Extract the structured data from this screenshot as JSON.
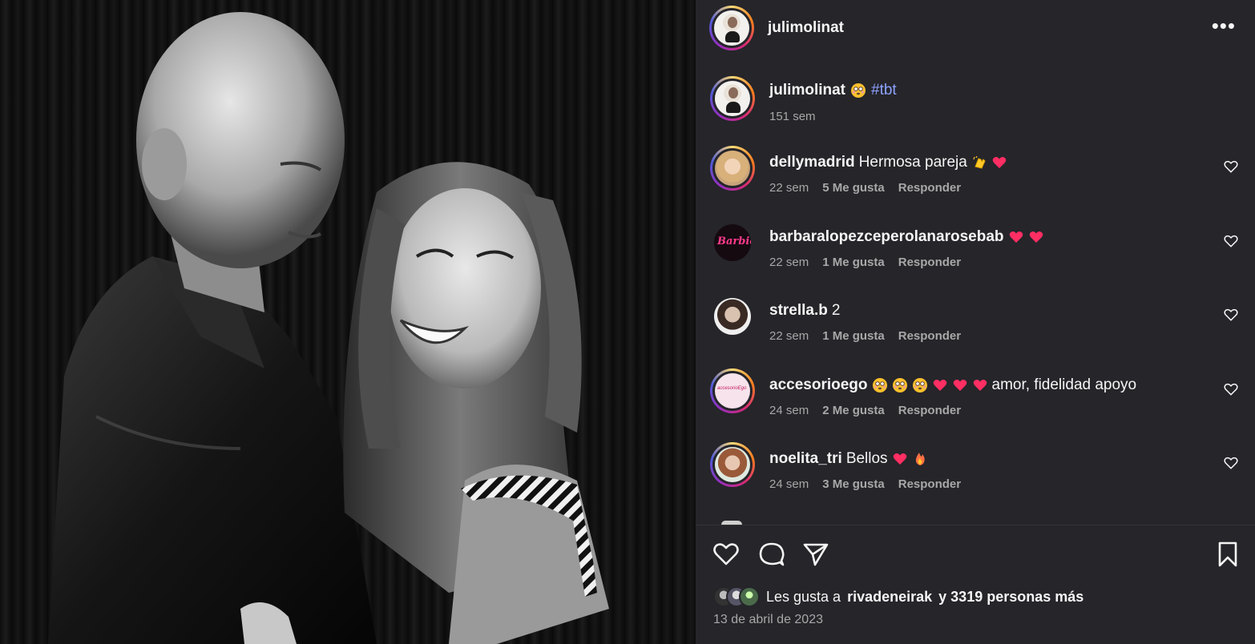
{
  "post": {
    "author": "julimolinat",
    "caption_hashtag": "#tbt",
    "caption_age": "151 sem",
    "likes_prefix": "Les gusta a",
    "likes_user": "rivadeneirak",
    "likes_suffix": "y 3319 personas más",
    "date": "13 de abril de 2023",
    "more_icon": "more-horizontal-icon"
  },
  "comments": [
    {
      "user": "dellymadrid",
      "text": "Hermosa pareja",
      "age": "22 sem",
      "likes": "5 Me gusta",
      "reply": "Responder"
    },
    {
      "user": "barbaralopezceperolanarosebab",
      "text": "",
      "age": "22 sem",
      "likes": "1 Me gusta",
      "reply": "Responder"
    },
    {
      "user": "strella.b",
      "text": "2",
      "age": "22 sem",
      "likes": "1 Me gusta",
      "reply": "Responder"
    },
    {
      "user": "accesorioego",
      "text": "amor, fidelidad apoyo",
      "age": "24 sem",
      "likes": "2 Me gusta",
      "reply": "Responder"
    },
    {
      "user": "noelita_tri",
      "text": "Bellos",
      "age": "24 sem",
      "likes": "3 Me gusta",
      "reply": "Responder"
    }
  ],
  "avatar_labels": {
    "barbara": "Barbie",
    "accesorio": "accesorioEgo"
  },
  "colors": {
    "panel_bg": "#25252a",
    "hashtag": "#8ea2ff",
    "muted": "#a8a8a8",
    "heart": "#ff2e63"
  }
}
